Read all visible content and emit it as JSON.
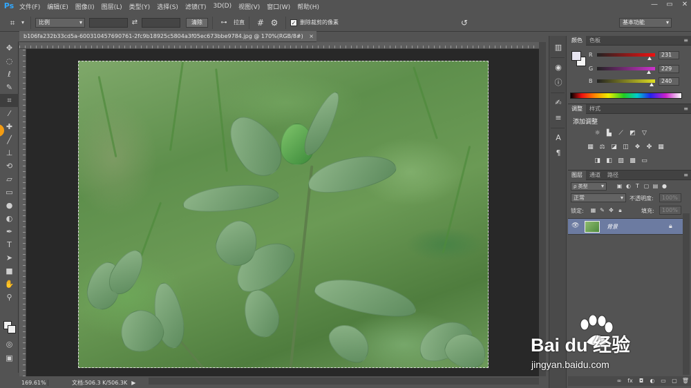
{
  "app": {
    "logo": "Ps"
  },
  "menu": [
    "文件(F)",
    "编辑(E)",
    "图像(I)",
    "图层(L)",
    "类型(Y)",
    "选择(S)",
    "滤镜(T)",
    "3D(D)",
    "视图(V)",
    "窗口(W)",
    "帮助(H)"
  ],
  "window_controls": {
    "minimize": "—",
    "restore": "▭",
    "close": "✕"
  },
  "options": {
    "ratio_select": "比例",
    "clear_button": "清除",
    "straighten_label": "拉直",
    "delete_cropped_label": "删除裁剪的像素",
    "delete_cropped_checked": true,
    "workspace_select": "基本功能"
  },
  "document": {
    "tab_title": "b106fa232b33cd5a-600310457690761-2fc9b18925c5804a3f05ec673bbe9784.jpg @ 170%(RGB/8#)",
    "tab_close": "×"
  },
  "status": {
    "zoom": "169.61%",
    "doc": "文档:506.3 K/506.3K",
    "arrow": "▶"
  },
  "color_panel": {
    "tabs": [
      "颜色",
      "色板"
    ],
    "sliders": [
      {
        "letter": "R",
        "value": "231",
        "color": "#e11",
        "fraction": 0.906
      },
      {
        "letter": "G",
        "value": "229",
        "color": "#c3c",
        "fraction": 0.898
      },
      {
        "letter": "B",
        "value": "240",
        "color": "#dd2",
        "fraction": 0.941
      }
    ],
    "foreground": "#e7e5f0"
  },
  "adjust_panel": {
    "tabs": [
      "调整",
      "样式"
    ],
    "title": "添加调整"
  },
  "layers_panel": {
    "tabs": [
      "图层",
      "通道",
      "路径"
    ],
    "filter": "ρ 类型",
    "blend_mode": "正常",
    "opacity_label": "不透明度:",
    "opacity_value": "100%",
    "lock_label": "锁定:",
    "fill_label": "填充:",
    "fill_value": "100%",
    "layer": {
      "name": "背景",
      "visible": true,
      "locked": true
    }
  },
  "watermark": {
    "brand": "Bai du 经验",
    "url": "jingyan.baidu.com"
  }
}
